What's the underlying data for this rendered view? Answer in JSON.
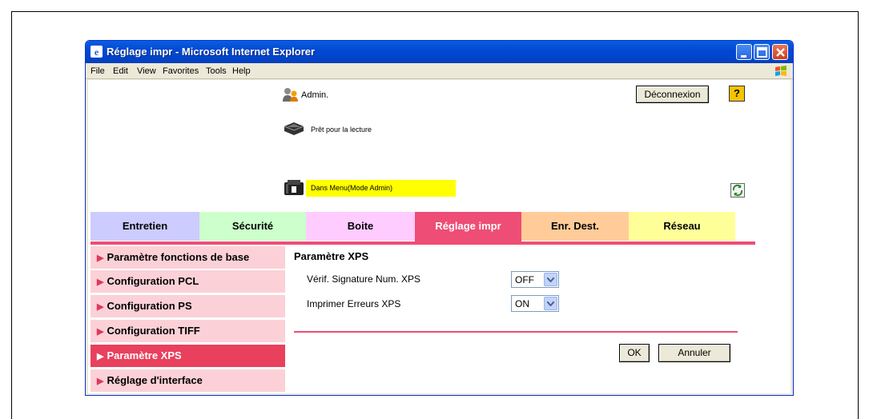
{
  "window": {
    "title": "Réglage impr - Microsoft Internet Explorer",
    "icon": "ie-icon",
    "controls": [
      "minimize-icon",
      "maximize-icon",
      "close-icon"
    ]
  },
  "menubar": {
    "items": [
      {
        "label": "File"
      },
      {
        "label": "Edit"
      },
      {
        "label": "View"
      },
      {
        "label": "Favorites"
      },
      {
        "label": "Tools"
      },
      {
        "label": "Help"
      }
    ]
  },
  "header": {
    "user_label": "Admin.",
    "logout_label": "Déconnexion",
    "help_label": "?",
    "status_ready": "Prêt pour la lecture",
    "status_menu": "Dans Menu(Mode Admin)",
    "status_menu_color": "#ffff00"
  },
  "tabs": [
    {
      "label": "Entretien",
      "color": "#ccccff"
    },
    {
      "label": "Sécurité",
      "color": "#ccffcc"
    },
    {
      "label": "Boite",
      "color": "#ffccff"
    },
    {
      "label": "Réglage impr",
      "color": "#ee4d75",
      "active": true
    },
    {
      "label": "Enr. Dest.",
      "color": "#ffcc99"
    },
    {
      "label": "Réseau",
      "color": "#ffff99"
    }
  ],
  "sidebar": {
    "items": [
      {
        "label": "Paramètre fonctions de base"
      },
      {
        "label": "Configuration PCL"
      },
      {
        "label": "Configuration PS"
      },
      {
        "label": "Configuration TIFF"
      },
      {
        "label": "Paramètre XPS",
        "active": true
      },
      {
        "label": "Réglage d'interface"
      }
    ]
  },
  "main": {
    "section_title": "Paramètre XPS",
    "fields": [
      {
        "label": "Vérif. Signature Num. XPS",
        "value": "OFF"
      },
      {
        "label": "Imprimer Erreurs XPS",
        "value": "ON"
      }
    ],
    "ok_label": "OK",
    "cancel_label": "Annuler"
  },
  "colors": {
    "accent": "#ee4d75",
    "sidebar_bg": "#fbd1d7",
    "sidebar_active": "#e8405d"
  }
}
